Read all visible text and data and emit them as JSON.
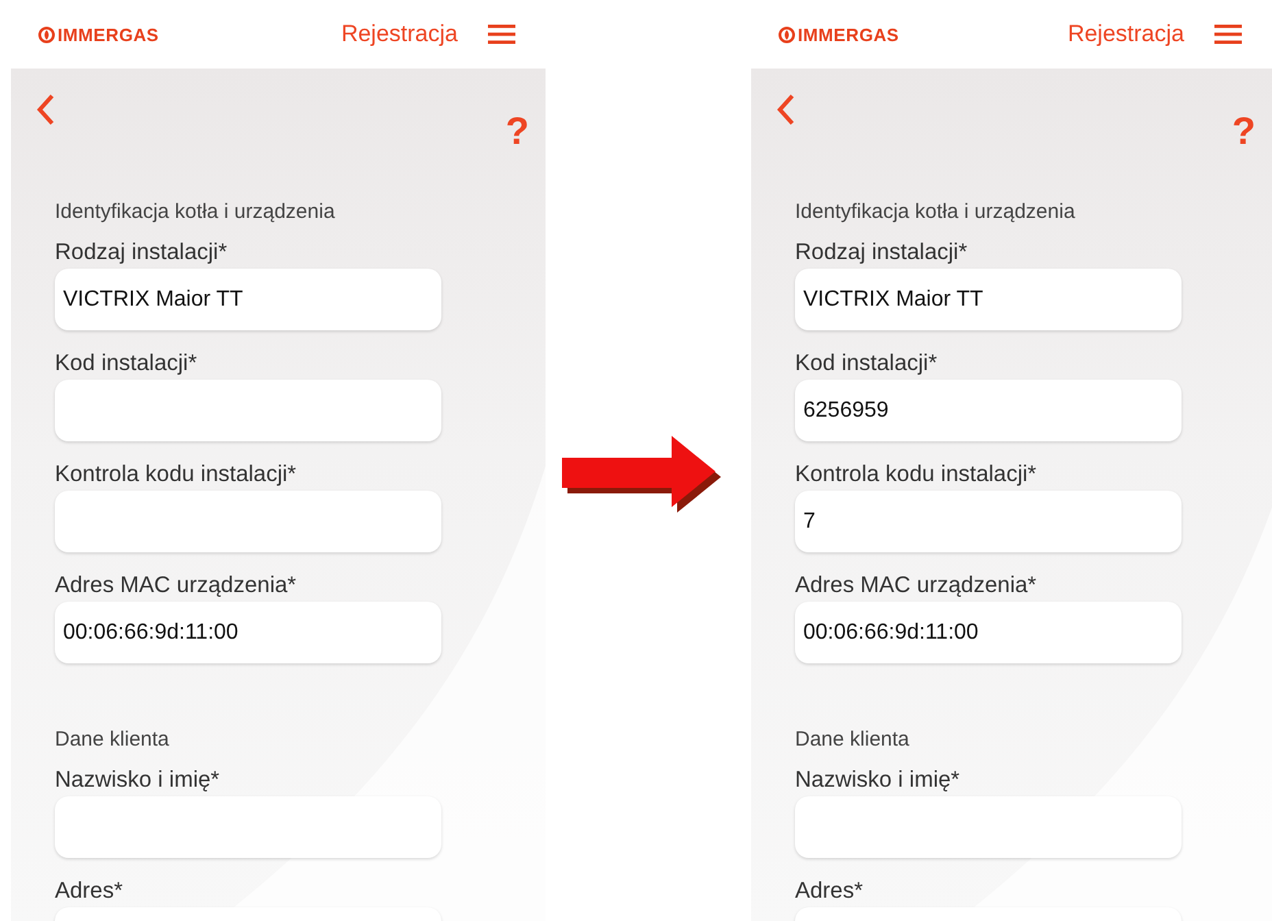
{
  "screens": [
    {
      "header": {
        "logo": "IMMERGAS",
        "title": "Rejestracja"
      },
      "help": "?",
      "sections": [
        {
          "title": "Identyfikacja kotła i urządzenia",
          "fields": [
            {
              "label": "Rodzaj instalacji*",
              "value": "VICTRIX Maior TT"
            },
            {
              "label": "Kod instalacji*"
            },
            {
              "label": "Kontrola kodu instalacji*"
            },
            {
              "label": "Adres MAC urządzenia*",
              "value": "00:06:66:9d:11:00"
            }
          ]
        },
        {
          "title": "Dane klienta",
          "fields": [
            {
              "label": "Nazwisko i imię*"
            },
            {
              "label": "Adres*"
            }
          ]
        }
      ]
    },
    {
      "header": {
        "logo": "IMMERGAS",
        "title": "Rejestracja"
      },
      "help": "?",
      "sections": [
        {
          "title": "Identyfikacja kotła i urządzenia",
          "fields": [
            {
              "label": "Rodzaj instalacji*",
              "value": "VICTRIX Maior TT"
            },
            {
              "label": "Kod instalacji*",
              "value": "6256959"
            },
            {
              "label": "Kontrola kodu instalacji*",
              "value": "7"
            },
            {
              "label": "Adres MAC urządzenia*",
              "value": "00:06:66:9d:11:00"
            }
          ]
        },
        {
          "title": "Dane klienta",
          "fields": [
            {
              "label": "Nazwisko i imię*"
            },
            {
              "label": "Adres*"
            }
          ]
        }
      ]
    }
  ]
}
